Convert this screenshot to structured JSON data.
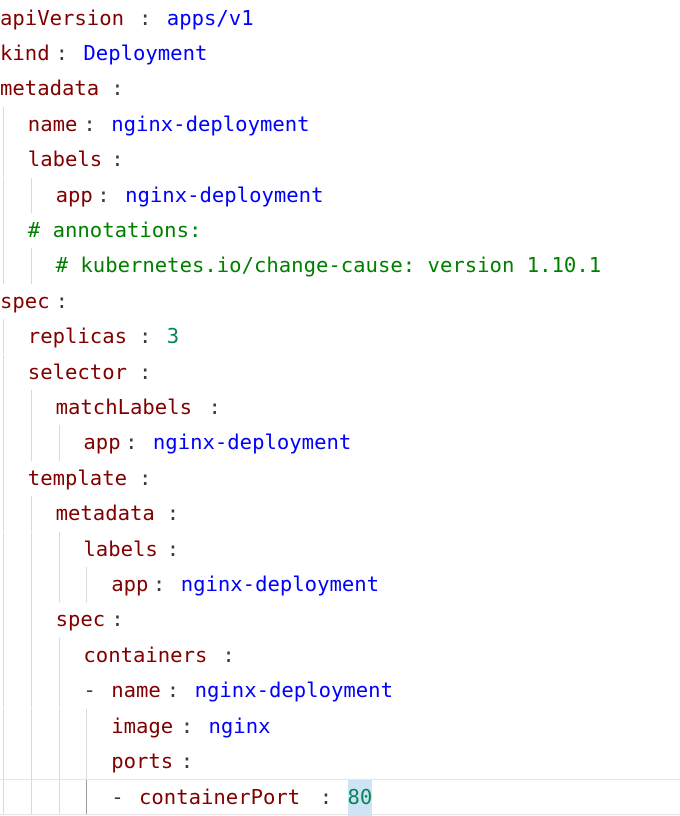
{
  "editor": {
    "lines": [
      {
        "indent": 0,
        "type": "pair",
        "key": "apiVersion",
        "value": "apps/v1",
        "value_kind": "string"
      },
      {
        "indent": 0,
        "type": "pair",
        "key": "kind",
        "value": "Deployment",
        "value_kind": "string"
      },
      {
        "indent": 0,
        "type": "key",
        "key": "metadata"
      },
      {
        "indent": 1,
        "type": "pair",
        "key": "name",
        "value": "nginx-deployment",
        "value_kind": "string"
      },
      {
        "indent": 1,
        "type": "key",
        "key": "labels"
      },
      {
        "indent": 2,
        "type": "pair",
        "key": "app",
        "value": "nginx-deployment",
        "value_kind": "string"
      },
      {
        "indent": 1,
        "type": "comment",
        "text": "# annotations:"
      },
      {
        "indent": 2,
        "type": "comment",
        "text": "# kubernetes.io/change-cause: version 1.10.1"
      },
      {
        "indent": 0,
        "type": "key",
        "key": "spec"
      },
      {
        "indent": 1,
        "type": "pair",
        "key": "replicas",
        "value": "3",
        "value_kind": "number"
      },
      {
        "indent": 1,
        "type": "key",
        "key": "selector"
      },
      {
        "indent": 2,
        "type": "key",
        "key": "matchLabels"
      },
      {
        "indent": 3,
        "type": "pair",
        "key": "app",
        "value": "nginx-deployment",
        "value_kind": "string"
      },
      {
        "indent": 1,
        "type": "key",
        "key": "template"
      },
      {
        "indent": 2,
        "type": "key",
        "key": "metadata"
      },
      {
        "indent": 3,
        "type": "key",
        "key": "labels"
      },
      {
        "indent": 4,
        "type": "pair",
        "key": "app",
        "value": "nginx-deployment",
        "value_kind": "string"
      },
      {
        "indent": 2,
        "type": "key",
        "key": "spec"
      },
      {
        "indent": 3,
        "type": "key",
        "key": "containers"
      },
      {
        "indent": 3,
        "type": "pair",
        "dash": true,
        "key": "name",
        "value": "nginx-deployment",
        "value_kind": "string"
      },
      {
        "indent": 4,
        "type": "pair",
        "key": "image",
        "value": "nginx",
        "value_kind": "string"
      },
      {
        "indent": 4,
        "type": "key",
        "key": "ports"
      },
      {
        "indent": 4,
        "type": "pair",
        "dash": true,
        "key": "containerPort",
        "value": "80",
        "value_kind": "number",
        "current": true,
        "highlight": true
      }
    ]
  },
  "colors": {
    "key": "#800000",
    "string_value": "#0000ff",
    "number_value": "#098658",
    "comment": "#008000",
    "punctuation": "#3b3b3b",
    "indent_guide": "#d9d9d9",
    "active_indent_guide": "#9a9a9a",
    "selection_highlight": "#cfe3f6"
  }
}
